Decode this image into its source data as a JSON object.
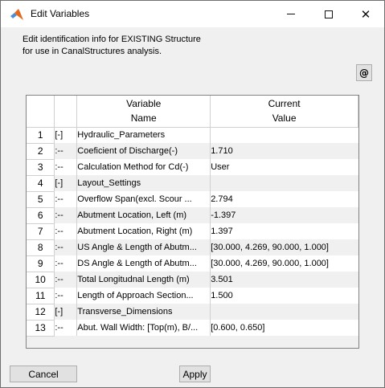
{
  "window": {
    "title": "Edit Variables",
    "controls": [
      "minimize",
      "maximize",
      "close"
    ]
  },
  "description": {
    "line1": "Edit identification info for EXISTING Structure",
    "line2": "for use in CanalStructures analysis."
  },
  "at_button": {
    "label": "@"
  },
  "table": {
    "headers": {
      "name_line1": "Variable",
      "name_line2": "Name",
      "value_line1": "Current",
      "value_line2": "Value"
    },
    "rows": [
      {
        "num": "1",
        "mark": "[-]",
        "name": "Hydraulic_Parameters",
        "value": ""
      },
      {
        "num": "2",
        "mark": ":--",
        "name": "Coeficient of Discharge(-)",
        "value": "1.710"
      },
      {
        "num": "3",
        "mark": ":--",
        "name": "Calculation Method for Cd(-)",
        "value": "User"
      },
      {
        "num": "4",
        "mark": "[-]",
        "name": "Layout_Settings",
        "value": ""
      },
      {
        "num": "5",
        "mark": ":--",
        "name": "Overflow Span(excl. Scour ...",
        "value": "2.794"
      },
      {
        "num": "6",
        "mark": ":--",
        "name": "Abutment Location, Left (m)",
        "value": "-1.397"
      },
      {
        "num": "7",
        "mark": ":--",
        "name": "Abutment Location, Right (m)",
        "value": "1.397"
      },
      {
        "num": "8",
        "mark": ":--",
        "name": "US Angle & Length of Abutm...",
        "value": "[30.000, 4.269, 90.000, 1.000]"
      },
      {
        "num": "9",
        "mark": ":--",
        "name": "DS Angle & Length of Abutm...",
        "value": "[30.000, 4.269, 90.000, 1.000]"
      },
      {
        "num": "10",
        "mark": ":--",
        "name": "Total Longitudnal Length (m)",
        "value": "3.501"
      },
      {
        "num": "11",
        "mark": ":--",
        "name": "Length of Approach Section...",
        "value": "1.500"
      },
      {
        "num": "12",
        "mark": "[-]",
        "name": "Transverse_Dimensions",
        "value": ""
      },
      {
        "num": "13",
        "mark": ":--",
        "name": "Abut. Wall Width: [Top(m), B/...",
        "value": "[0.600, 0.650]"
      }
    ]
  },
  "buttons": {
    "cancel": "Cancel",
    "apply": "Apply"
  },
  "colors": {
    "window_bg": "#f0f0f0",
    "row_alt": "#f0f0f0",
    "button_bg": "#e1e1e1"
  }
}
